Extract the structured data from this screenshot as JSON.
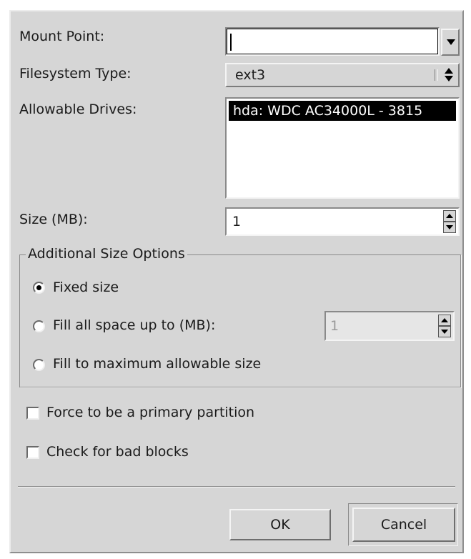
{
  "form": {
    "mount_point_label": "Mount Point:",
    "mount_point_value": "",
    "filesystem_label": "Filesystem Type:",
    "filesystem_value": "ext3",
    "drives_label": "Allowable Drives:",
    "drives": [
      {
        "text": "hda: WDC AC34000L - 3815",
        "selected": true
      }
    ],
    "size_label": "Size (MB):",
    "size_value": "1"
  },
  "size_options": {
    "title": "Additional Size Options",
    "fixed_label": "Fixed size",
    "fill_upto_label": "Fill all space up to (MB):",
    "fill_upto_value": "1",
    "fill_max_label": "Fill to maximum allowable size",
    "selected": "fixed"
  },
  "checkboxes": {
    "primary_label": "Force to be a primary partition",
    "primary_checked": false,
    "badblocks_label": "Check for bad blocks",
    "badblocks_checked": false
  },
  "buttons": {
    "ok": "OK",
    "cancel": "Cancel"
  },
  "icons": {
    "combo_arrow": "chevron-down-icon",
    "spin_arrows": "spin-arrows-icon",
    "radio_selected": "radio-dot-icon"
  }
}
